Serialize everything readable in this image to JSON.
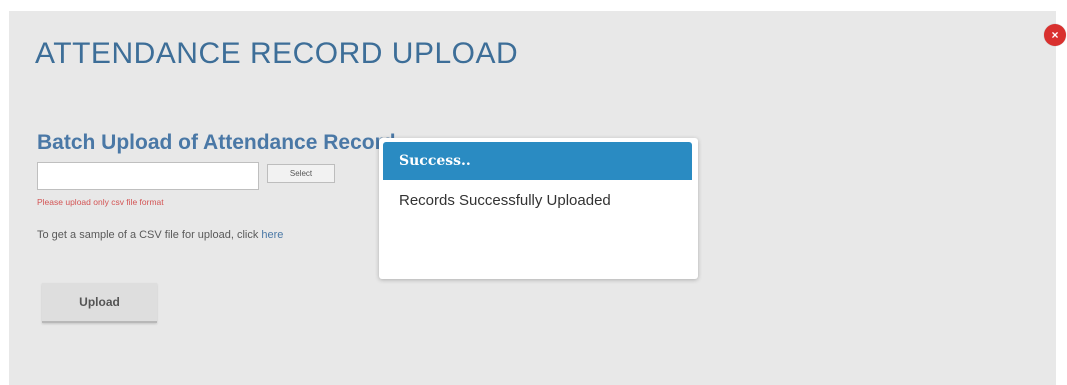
{
  "modal": {
    "title": "ATTENDANCE RECORD UPLOAD",
    "close_label": "×",
    "section_heading": "Batch Upload of Attendance Record",
    "file_input": {
      "value": "",
      "select_label": "Select"
    },
    "format_note": "Please upload only csv file format",
    "sample_text": "To get a sample of a CSV file for upload, click ",
    "sample_link": "here",
    "upload_label": "Upload"
  },
  "popup": {
    "title": "Success..",
    "message": "Records Successfully Uploaded"
  },
  "colors": {
    "title": "#3d6e98",
    "popup_header": "#2a8bc2",
    "close_button": "#d9302e",
    "error_text": "#d35454",
    "modal_background": "#e8e8e8"
  }
}
